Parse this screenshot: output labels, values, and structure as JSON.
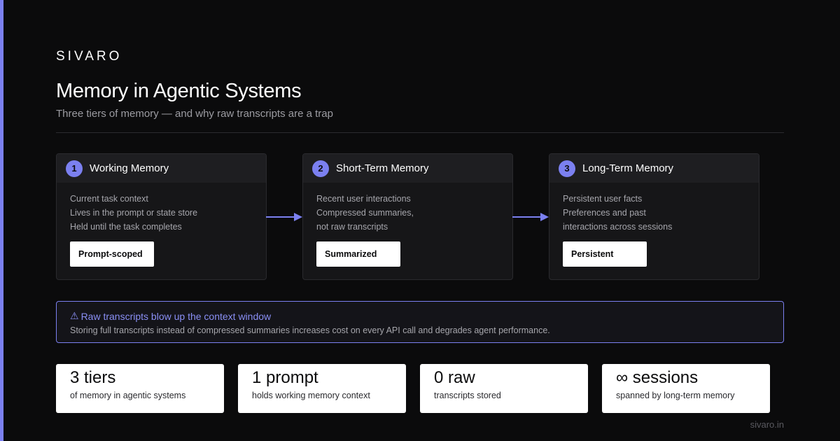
{
  "brand": "SIVARO",
  "title": "Memory in Agentic Systems",
  "subtitle": "Three tiers of memory — and why raw transcripts are a trap",
  "colors": {
    "accent": "#7b80f0",
    "background": "#0b0b0c",
    "card": "#161618"
  },
  "tiers": [
    {
      "number": "1",
      "title": "Working Memory",
      "lines": [
        "Current task context",
        "Lives in the prompt or state store",
        "Held until the task completes"
      ],
      "tag": "Prompt-scoped"
    },
    {
      "number": "2",
      "title": "Short-Term Memory",
      "lines": [
        "Recent user interactions",
        "Compressed summaries,",
        "not raw transcripts"
      ],
      "tag": "Summarized"
    },
    {
      "number": "3",
      "title": "Long-Term Memory",
      "lines": [
        "Persistent user facts",
        "Preferences and past",
        "interactions across sessions"
      ],
      "tag": "Persistent"
    }
  ],
  "warning": {
    "icon": "⚠",
    "title": "Raw transcripts blow up the context window",
    "text": "Storing full transcripts instead of compressed summaries increases cost on every API call and degrades agent performance."
  },
  "stats": [
    {
      "value": "3 tiers",
      "label": "of memory in agentic systems"
    },
    {
      "value": "1 prompt",
      "label": "holds working memory context"
    },
    {
      "value": "0 raw",
      "label": "transcripts stored"
    },
    {
      "value": "∞ sessions",
      "label": "spanned by long-term memory"
    }
  ],
  "footer": "sivaro.in"
}
